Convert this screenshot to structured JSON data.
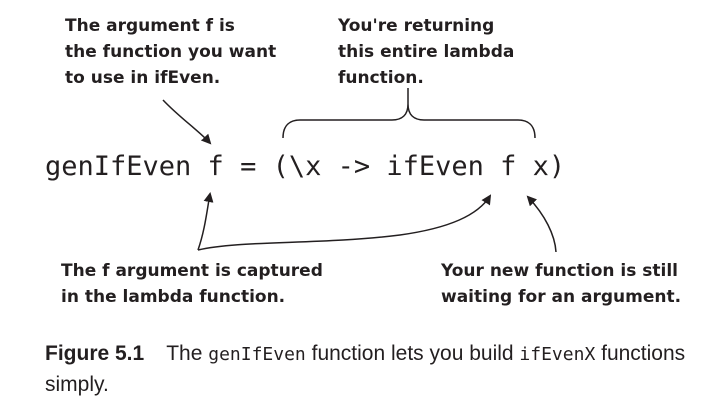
{
  "annotations": {
    "arg_f": "The argument f is\nthe function you want\nto use in ifEven.",
    "returning": "You're returning\nthis entire lambda\nfunction.",
    "captured": "The f argument is captured\nin the lambda function.",
    "waiting": "Your new function is still\nwaiting for an argument."
  },
  "code": "genIfEven f = (\\x -> ifEven f x)",
  "caption": {
    "label": "Figure 5.1",
    "text_before": "The ",
    "code_1": "genIfEven",
    "text_middle": " function lets you build ",
    "code_2": "ifEvenX",
    "text_after": " functions simply."
  }
}
